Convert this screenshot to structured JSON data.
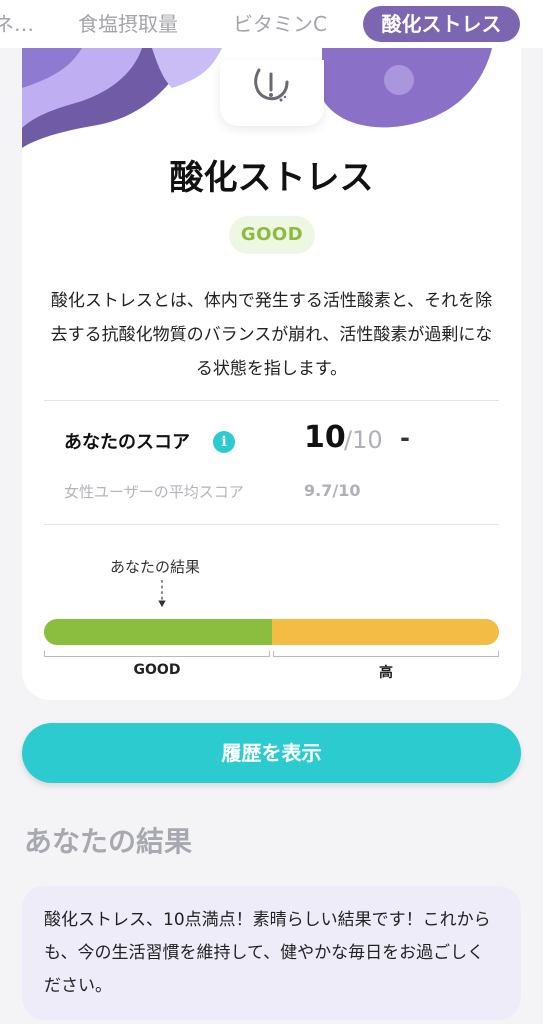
{
  "tabs": [
    {
      "label": "ネ…",
      "active": false
    },
    {
      "label": "食塩摂取量",
      "active": false
    },
    {
      "label": "ビタミンC",
      "active": false
    },
    {
      "label": "酸化ストレス",
      "active": true
    }
  ],
  "card": {
    "icon": "stress-face-icon",
    "title": "酸化ストレス",
    "badge": "GOOD",
    "description": "酸化ストレスとは、体内で発生する活性酸素と、それを除去する抗酸化物質のバランスが崩れ、活性酸素が過剰になる状態を指します。",
    "score": {
      "label": "あなたのスコア",
      "value": "10",
      "max": "/10",
      "trend": "-",
      "average_label": "女性ユーザーの平均スコア",
      "average_value": "9.7/10"
    },
    "gauge": {
      "marker_label": "あなたの結果",
      "segments": [
        {
          "label": "GOOD",
          "color": "#8bbd3f"
        },
        {
          "label": "高",
          "color": "#f3bd45"
        }
      ]
    }
  },
  "history_button": "履歴を表示",
  "result_section": {
    "title": "あなたの結果",
    "message": "酸化ストレス、10点満点！素晴らしい結果です！これからも、今の生活習慣を維持して、健やかな毎日をお過ごしください。"
  },
  "colors": {
    "accent_purple": "#7d66b1",
    "teal": "#2ccbd0",
    "good_green": "#8bbd3f",
    "high_yellow": "#f3bd45"
  }
}
